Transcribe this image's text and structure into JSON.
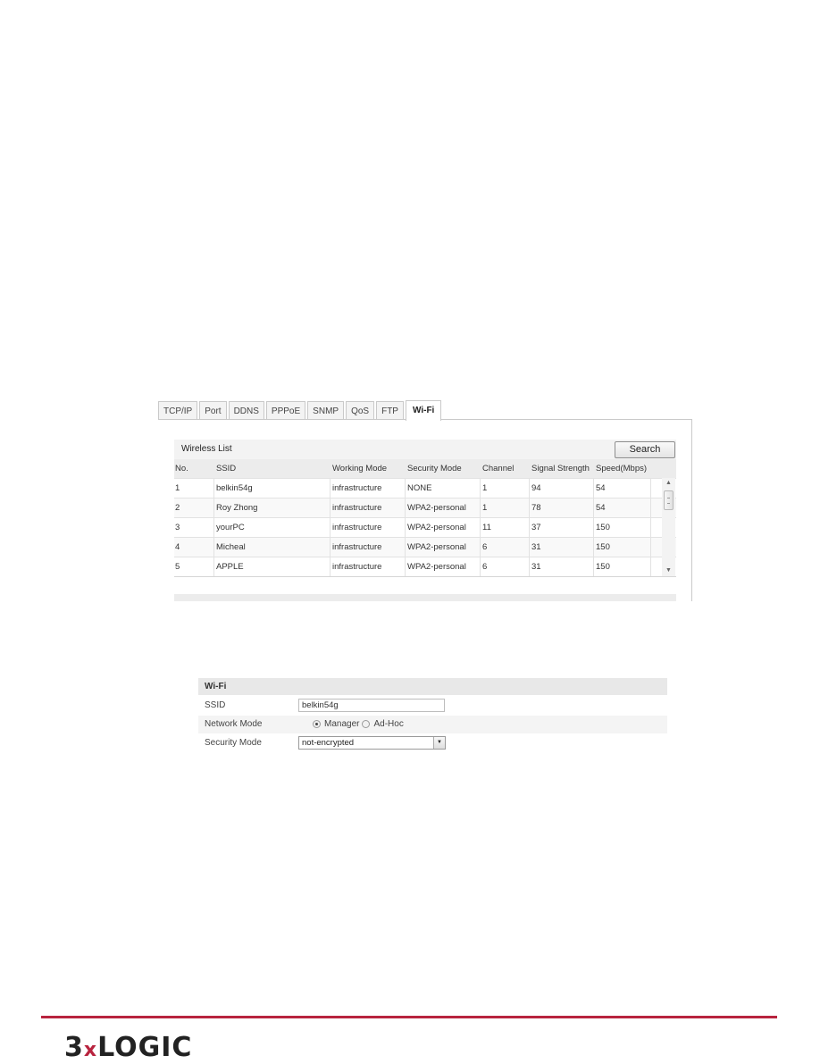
{
  "tabs": [
    {
      "label": "TCP/IP",
      "active": false
    },
    {
      "label": "Port",
      "active": false
    },
    {
      "label": "DDNS",
      "active": false
    },
    {
      "label": "PPPoE",
      "active": false
    },
    {
      "label": "SNMP",
      "active": false
    },
    {
      "label": "QoS",
      "active": false
    },
    {
      "label": "FTP",
      "active": false
    },
    {
      "label": "Wi-Fi",
      "active": true
    }
  ],
  "wireless_list": {
    "title": "Wireless List",
    "search_label": "Search",
    "columns": [
      "No.",
      "SSID",
      "Working Mode",
      "Security Mode",
      "Channel",
      "Signal Strength",
      "Speed(Mbps)"
    ],
    "rows": [
      {
        "no": "1",
        "ssid": "belkin54g",
        "working_mode": "infrastructure",
        "security_mode": "NONE",
        "channel": "1",
        "signal": "94",
        "speed": "54"
      },
      {
        "no": "2",
        "ssid": "Roy Zhong",
        "working_mode": "infrastructure",
        "security_mode": "WPA2-personal",
        "channel": "1",
        "signal": "78",
        "speed": "54"
      },
      {
        "no": "3",
        "ssid": "yourPC",
        "working_mode": "infrastructure",
        "security_mode": "WPA2-personal",
        "channel": "11",
        "signal": "37",
        "speed": "150"
      },
      {
        "no": "4",
        "ssid": "Micheal",
        "working_mode": "infrastructure",
        "security_mode": "WPA2-personal",
        "channel": "6",
        "signal": "31",
        "speed": "150"
      },
      {
        "no": "5",
        "ssid": "APPLE",
        "working_mode": "infrastructure",
        "security_mode": "WPA2-personal",
        "channel": "6",
        "signal": "31",
        "speed": "150"
      }
    ],
    "scroll_up_icon": "▲",
    "scroll_down_icon": "▼"
  },
  "wifi_form": {
    "title": "Wi-Fi",
    "ssid_label": "SSID",
    "ssid_value": "belkin54g",
    "network_mode_label": "Network Mode",
    "network_mode_options": [
      "Manager",
      "Ad-Hoc"
    ],
    "network_mode_selected": "Manager",
    "security_mode_label": "Security Mode",
    "security_mode_value": "not-encrypted",
    "dropdown_icon": "▼"
  },
  "footer": {
    "accent_color": "#b8233e",
    "logo_prefix": "3",
    "logo_x": "x",
    "logo_suffix": "LOGIC"
  }
}
